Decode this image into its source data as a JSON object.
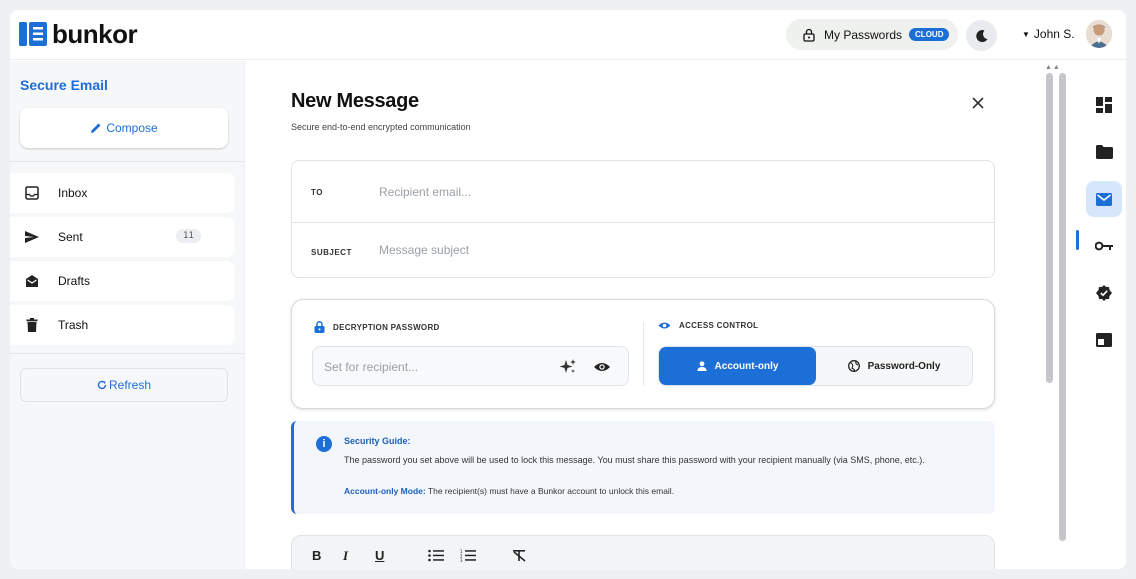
{
  "brand": {
    "name": "bunkor",
    "accent": "#1d6fd8"
  },
  "header": {
    "my_passwords_label": "My Passwords",
    "cloud_badge": "CLOUD",
    "user_name": "John S."
  },
  "sidebar": {
    "section_title": "Secure Email",
    "compose_label": "Compose",
    "items": [
      {
        "label": "Inbox",
        "icon": "inbox-icon"
      },
      {
        "label": "Sent",
        "icon": "send-icon",
        "count": "11"
      },
      {
        "label": "Drafts",
        "icon": "drafts-icon"
      },
      {
        "label": "Trash",
        "icon": "trash-icon"
      }
    ],
    "refresh_label": "Refresh"
  },
  "compose_form": {
    "title": "New Message",
    "subtitle": "Secure end-to-end encrypted communication",
    "to_label": "TO",
    "to_placeholder": "Recipient email...",
    "subject_label": "SUBJECT",
    "subject_placeholder": "Message subject",
    "decryption_label": "DECRYPTION PASSWORD",
    "password_placeholder": "Set for recipient...",
    "access_label": "ACCESS CONTROL",
    "access_options": [
      "Account-only",
      "Password-Only"
    ],
    "access_selected": "Account-only"
  },
  "guide": {
    "title": "Security Guide:",
    "text": "The password you set above will be used to lock this message. You must share this password with your recipient manually (via SMS, phone, etc.).",
    "mode_label": "Account-only Mode:",
    "mode_text": " The recipient(s) must have a Bunkor account to unlock this email."
  },
  "editor_toolbar": {
    "bold": "B",
    "italic": "I",
    "underline": "U"
  },
  "rail_icons": [
    "dashboard-icon",
    "folder-icon",
    "mail-icon",
    "key-icon",
    "verified-badge-icon",
    "window-icon"
  ],
  "rail_active": "mail-icon"
}
